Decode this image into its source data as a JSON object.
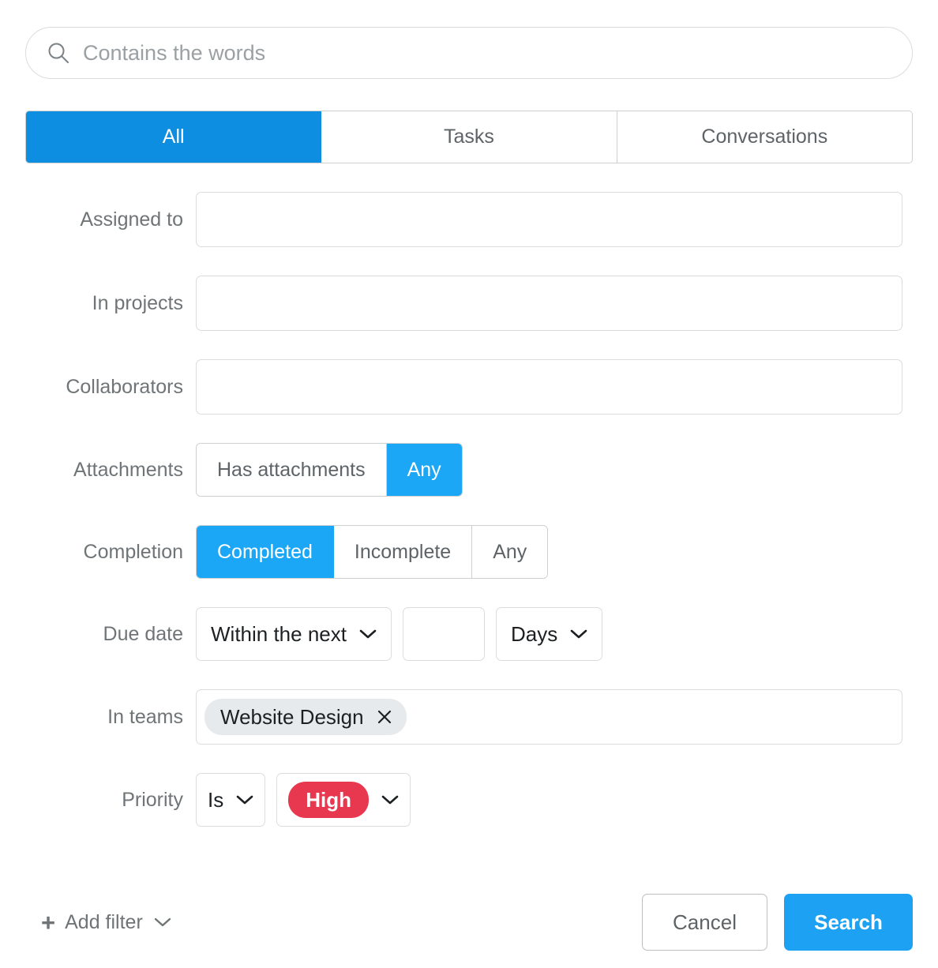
{
  "search": {
    "placeholder": "Contains the words",
    "value": "",
    "icon": "search-icon"
  },
  "tabs": {
    "items": [
      {
        "label": "All",
        "active": true
      },
      {
        "label": "Tasks",
        "active": false
      },
      {
        "label": "Conversations",
        "active": false
      }
    ]
  },
  "filters": {
    "assigned_to": {
      "label": "Assigned to",
      "value": "",
      "placeholder": ""
    },
    "in_projects": {
      "label": "In projects",
      "value": "",
      "placeholder": ""
    },
    "collaborators": {
      "label": "Collaborators",
      "value": "",
      "placeholder": ""
    },
    "attachments": {
      "label": "Attachments",
      "options": [
        "Has attachments",
        "Any"
      ],
      "selected": "Any"
    },
    "completion": {
      "label": "Completion",
      "options": [
        "Completed",
        "Incomplete",
        "Any"
      ],
      "selected": "Completed"
    },
    "due_date": {
      "label": "Due date",
      "operator": "Within the next",
      "amount": "",
      "unit": "Days"
    },
    "in_teams": {
      "label": "In teams",
      "chips": [
        {
          "label": "Website Design",
          "remove_icon": "close-icon"
        }
      ]
    },
    "priority": {
      "label": "Priority",
      "operator": "Is",
      "value": "High",
      "value_color": "#e8384f"
    }
  },
  "footer": {
    "add_filter_label": "Add filter",
    "add_filter_plus": "+",
    "cancel_label": "Cancel",
    "search_label": "Search"
  },
  "colors": {
    "tab_active": "#0d8ee0",
    "segment_selected": "#1ba7f5",
    "primary_button": "#1da1f2",
    "priority_high": "#e8384f",
    "chip_background": "#e7eaec",
    "border": "#dcdcdc",
    "label_text": "#6f7477"
  }
}
